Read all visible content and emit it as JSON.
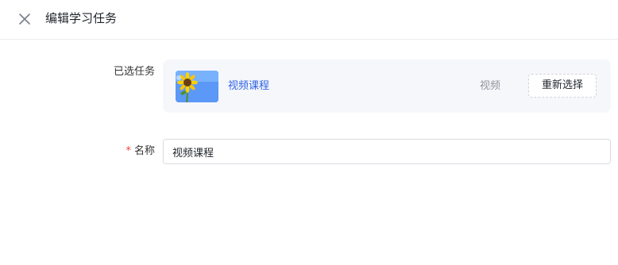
{
  "header": {
    "title": "编辑学习任务",
    "close_icon": "close-icon"
  },
  "form": {
    "selected_task_label": "已选任务",
    "name_label": "名称",
    "required_marker": "*",
    "name_value": "视频课程"
  },
  "selected_task": {
    "thumbnail_icon": "sunflower-thumbnail",
    "title": "视频课程",
    "type": "视频",
    "reselect_label": "重新选择"
  },
  "colors": {
    "link": "#2e64e6",
    "required": "#f53f3f",
    "card_background": "#f6f7fb",
    "muted_text": "#8f959e"
  }
}
